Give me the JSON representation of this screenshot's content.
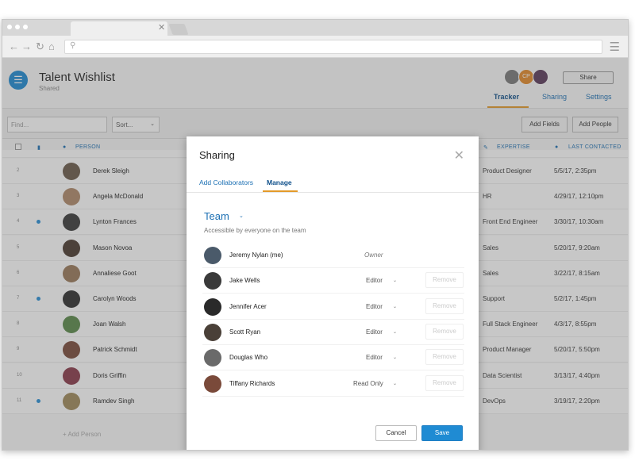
{
  "browser": {
    "url": ""
  },
  "header": {
    "title": "Talent Wishlist",
    "subtitle": "Shared",
    "avatar_initials": "CP",
    "share_label": "Share",
    "tabs": [
      "Tracker",
      "Sharing",
      "Settings"
    ],
    "active_tab": "Tracker"
  },
  "toolbar": {
    "find_placeholder": "Find...",
    "sort_label": "Sort...",
    "add_fields_label": "Add Fields",
    "add_people_label": "Add People"
  },
  "columns": {
    "person": "PERSON",
    "expertise": "EXPERTISE",
    "last_contacted": "LAST CONTACTED"
  },
  "rows": [
    {
      "num": "2",
      "name": "Derek Sleigh",
      "expertise": "Product Designer",
      "last": "5/5/17, 2:35pm",
      "flag": false,
      "color": "#6b5a4a"
    },
    {
      "num": "3",
      "name": "Angela McDonald",
      "expertise": "HR",
      "last": "4/29/17, 12:10pm",
      "flag": false,
      "color": "#b08a6a"
    },
    {
      "num": "4",
      "name": "Lynton Frances",
      "expertise": "Front End Engineer",
      "last": "3/30/17, 10:30am",
      "flag": true,
      "color": "#3a3a3a"
    },
    {
      "num": "5",
      "name": "Mason Novoa",
      "expertise": "Sales",
      "last": "5/20/17, 9:20am",
      "flag": false,
      "color": "#4a3a30"
    },
    {
      "num": "6",
      "name": "Annaliese Goot",
      "expertise": "Sales",
      "last": "3/22/17, 8:15am",
      "flag": false,
      "color": "#9a7a5a"
    },
    {
      "num": "7",
      "name": "Carolyn Woods",
      "expertise": "Support",
      "last": "5/2/17, 1:45pm",
      "flag": true,
      "color": "#2e2e2e"
    },
    {
      "num": "8",
      "name": "Joan Walsh",
      "expertise": "Full Stack Engineer",
      "last": "4/3/17, 8:55pm",
      "flag": false,
      "color": "#5a8a4a"
    },
    {
      "num": "9",
      "name": "Patrick Schmidt",
      "expertise": "Product Manager",
      "last": "5/20/17, 5:50pm",
      "flag": false,
      "color": "#7a4a3a"
    },
    {
      "num": "10",
      "name": "Doris Griffin",
      "expertise": "Data Scientist",
      "last": "3/13/17, 4:40pm",
      "flag": false,
      "color": "#8a3a4a"
    },
    {
      "num": "11",
      "name": "Ramdev Singh",
      "expertise": "DevOps",
      "last": "3/19/17, 2:20pm",
      "flag": true,
      "color": "#a08a5a"
    }
  ],
  "add_person_label": "+ Add Person",
  "modal": {
    "title": "Sharing",
    "tabs": [
      "Add Collaborators",
      "Manage"
    ],
    "active_tab": "Manage",
    "team_label": "Team",
    "team_sub": "Accessible by everyone on the team",
    "remove_label": "Remove",
    "cancel_label": "Cancel",
    "save_label": "Save",
    "members": [
      {
        "name": "Jeremy Nylan (me)",
        "role": "Owner",
        "owner": true,
        "color": "#4a5a6a"
      },
      {
        "name": "Jake Wells",
        "role": "Editor",
        "owner": false,
        "color": "#3a3a3a"
      },
      {
        "name": "Jennifer Acer",
        "role": "Editor",
        "owner": false,
        "color": "#2a2a2a"
      },
      {
        "name": "Scott Ryan",
        "role": "Editor",
        "owner": false,
        "color": "#4a4038"
      },
      {
        "name": "Douglas Who",
        "role": "Editor",
        "owner": false,
        "color": "#6a6a6a"
      },
      {
        "name": "Tiffany Richards",
        "role": "Read Only",
        "owner": false,
        "color": "#7a4a3a"
      }
    ]
  },
  "colors": {
    "accent": "#1f8bd3",
    "tab_underline": "#e39a2a",
    "dim_overlay": "rgba(80,80,80,0.32)"
  }
}
